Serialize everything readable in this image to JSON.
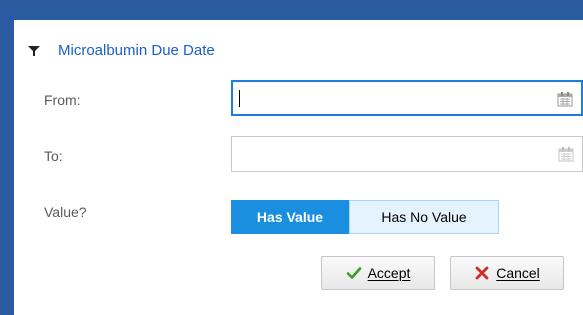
{
  "filter": {
    "title": "Microalbumin Due Date",
    "icon": "filter-icon",
    "accent_color": "#1a5fc8"
  },
  "from": {
    "label": "From:",
    "value": "",
    "icon": "calendar-icon"
  },
  "to": {
    "label": "To:",
    "value": "",
    "icon": "calendar-icon"
  },
  "value_toggle": {
    "label": "Value?",
    "options": [
      "Has Value",
      "Has No Value"
    ],
    "selected": "Has Value"
  },
  "actions": {
    "accept_label": "Accept",
    "accept_icon": "check-icon",
    "cancel_label": "Cancel",
    "cancel_icon": "x-icon"
  }
}
